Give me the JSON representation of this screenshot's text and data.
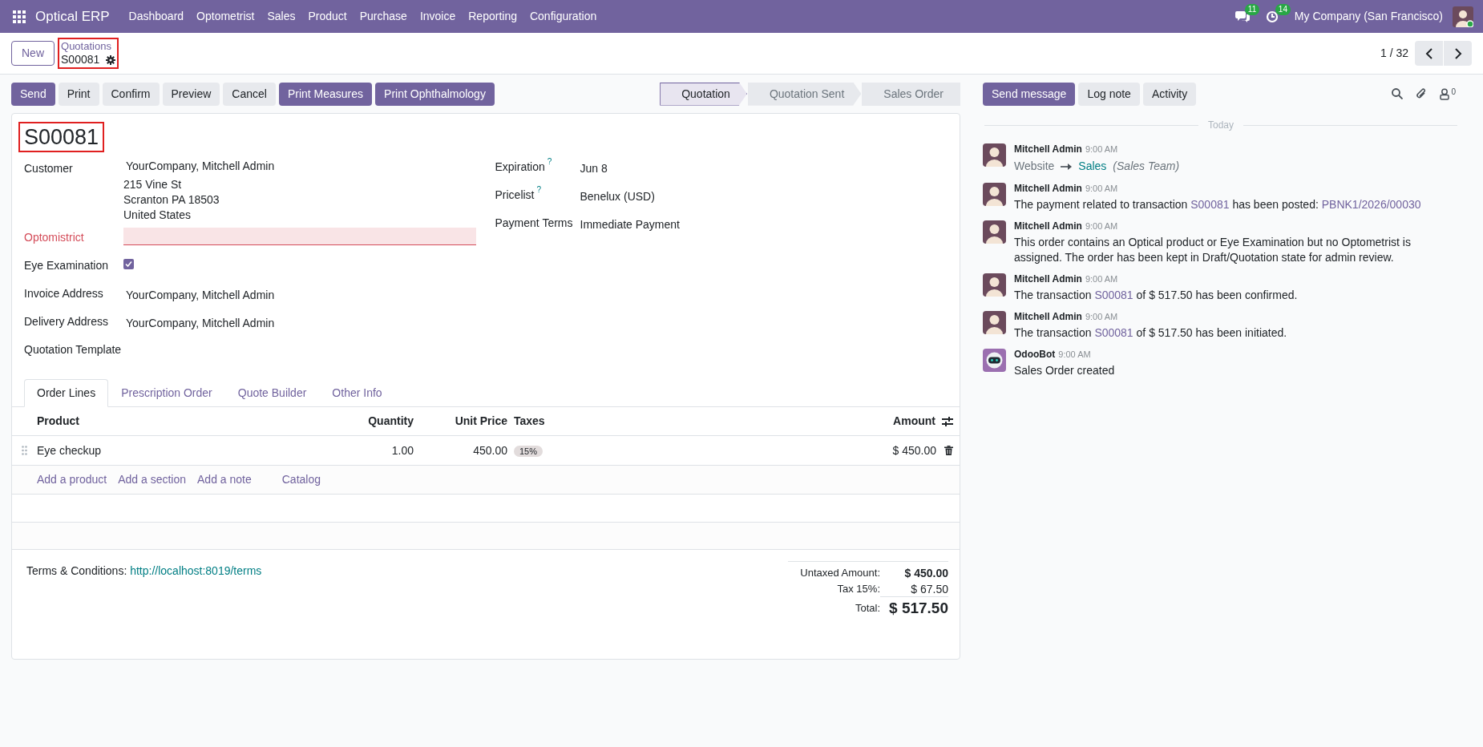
{
  "navbar": {
    "app_name": "Optical ERP",
    "menu": [
      "Dashboard",
      "Optometrist",
      "Sales",
      "Product",
      "Purchase",
      "Invoice",
      "Reporting",
      "Configuration"
    ],
    "messages_count": "11",
    "activities_count": "14",
    "company": "My Company (San Francisco)"
  },
  "control_panel": {
    "new_button": "New",
    "breadcrumb": {
      "parent": "Quotations",
      "current": "S00081",
      "highlighted": true
    },
    "pager": "1 / 32"
  },
  "actions": [
    {
      "label": "Send",
      "kind": "primary"
    },
    {
      "label": "Print",
      "kind": "secondary"
    },
    {
      "label": "Confirm",
      "kind": "secondary"
    },
    {
      "label": "Preview",
      "kind": "secondary"
    },
    {
      "label": "Cancel",
      "kind": "secondary"
    },
    {
      "label": "Print Measures",
      "kind": "primary"
    },
    {
      "label": "Print Ophthalmology",
      "kind": "primary"
    }
  ],
  "status_steps": [
    {
      "label": "Quotation",
      "selected": true
    },
    {
      "label": "Quotation Sent",
      "selected": false
    },
    {
      "label": "Sales Order",
      "selected": false
    }
  ],
  "chatter_buttons": [
    {
      "label": "Send message",
      "kind": "primary"
    },
    {
      "label": "Log note",
      "kind": "secondary"
    },
    {
      "label": "Activity",
      "kind": "secondary"
    }
  ],
  "follower_count": "0",
  "form": {
    "title": "S00081",
    "title_highlighted": true,
    "left_fields": [
      {
        "label": "Customer",
        "kind": "address",
        "lines": [
          "YourCompany, Mitchell Admin",
          "215 Vine St",
          "Scranton PA 18503",
          "United States"
        ]
      },
      {
        "label": "Optomistrict",
        "kind": "required_empty"
      },
      {
        "label": "Eye Examination",
        "kind": "checkbox",
        "checked": true
      },
      {
        "label": "Invoice Address",
        "kind": "text",
        "value": "YourCompany, Mitchell Admin"
      },
      {
        "label": "Delivery Address",
        "kind": "text",
        "value": "YourCompany, Mitchell Admin"
      },
      {
        "label": "Quotation Template",
        "kind": "empty"
      }
    ],
    "right_fields": [
      {
        "label": "Expiration",
        "help": "?",
        "value": "Jun 8"
      },
      {
        "label": "Pricelist",
        "help": "?",
        "value": "Benelux (USD)"
      },
      {
        "label": "Payment Terms",
        "value": "Immediate Payment"
      }
    ],
    "tabs": [
      {
        "label": "Order Lines",
        "selected": true
      },
      {
        "label": "Prescription Order",
        "selected": false
      },
      {
        "label": "Quote Builder",
        "selected": false
      },
      {
        "label": "Other Info",
        "selected": false
      }
    ],
    "order_lines": {
      "columns": [
        "Product",
        "Quantity",
        "Unit Price",
        "Taxes",
        "Amount"
      ],
      "rows": [
        {
          "product": "Eye checkup",
          "quantity": "1.00",
          "unit_price": "450.00",
          "taxes": "15%",
          "amount": "$ 450.00"
        }
      ],
      "add_links": [
        "Add a product",
        "Add a section",
        "Add a note",
        "Catalog"
      ]
    },
    "terms_label": "Terms & Conditions:",
    "terms_link": "http://localhost:8019/terms",
    "totals": [
      {
        "label": "Untaxed Amount:",
        "value": "$ 450.00",
        "kind": "subtotal"
      },
      {
        "label": "Tax 15%:",
        "value": "$ 67.50",
        "kind": "tax"
      },
      {
        "label": "Total:",
        "value": "$ 517.50",
        "kind": "total"
      }
    ]
  },
  "chatter": {
    "day": "Today",
    "messages": [
      {
        "author": "Mitchell Admin",
        "time": "9:00 AM",
        "is_bot": false,
        "kind": "tracking",
        "old": "Website",
        "new": "Sales",
        "field": "(Sales Team)"
      },
      {
        "author": "Mitchell Admin",
        "time": "9:00 AM",
        "is_bot": false,
        "kind": "text",
        "parts": [
          {
            "text": "The payment related to transaction ",
            "kind": "plain"
          },
          {
            "text": "S00081",
            "kind": "link"
          },
          {
            "text": " has been posted: ",
            "kind": "plain"
          },
          {
            "text": "PBNK1/2026/00030",
            "kind": "link"
          }
        ]
      },
      {
        "author": "Mitchell Admin",
        "time": "9:00 AM",
        "is_bot": false,
        "kind": "text",
        "parts": [
          {
            "text": "This order contains an Optical product or Eye Examination but no Optometrist is assigned. The order has been kept in Draft/Quotation state for admin review.",
            "kind": "plain"
          }
        ]
      },
      {
        "author": "Mitchell Admin",
        "time": "9:00 AM",
        "is_bot": false,
        "kind": "text",
        "parts": [
          {
            "text": "The transaction ",
            "kind": "plain"
          },
          {
            "text": "S00081",
            "kind": "link"
          },
          {
            "text": " of $ 517.50 has been confirmed.",
            "kind": "plain"
          }
        ]
      },
      {
        "author": "Mitchell Admin",
        "time": "9:00 AM",
        "is_bot": false,
        "kind": "text",
        "parts": [
          {
            "text": "The transaction ",
            "kind": "plain"
          },
          {
            "text": "S00081",
            "kind": "link"
          },
          {
            "text": " of $ 517.50 has been initiated.",
            "kind": "plain"
          }
        ]
      },
      {
        "author": "OdooBot",
        "time": "9:00 AM",
        "is_bot": true,
        "kind": "text",
        "parts": [
          {
            "text": "Sales Order created",
            "kind": "plain"
          }
        ]
      }
    ]
  }
}
